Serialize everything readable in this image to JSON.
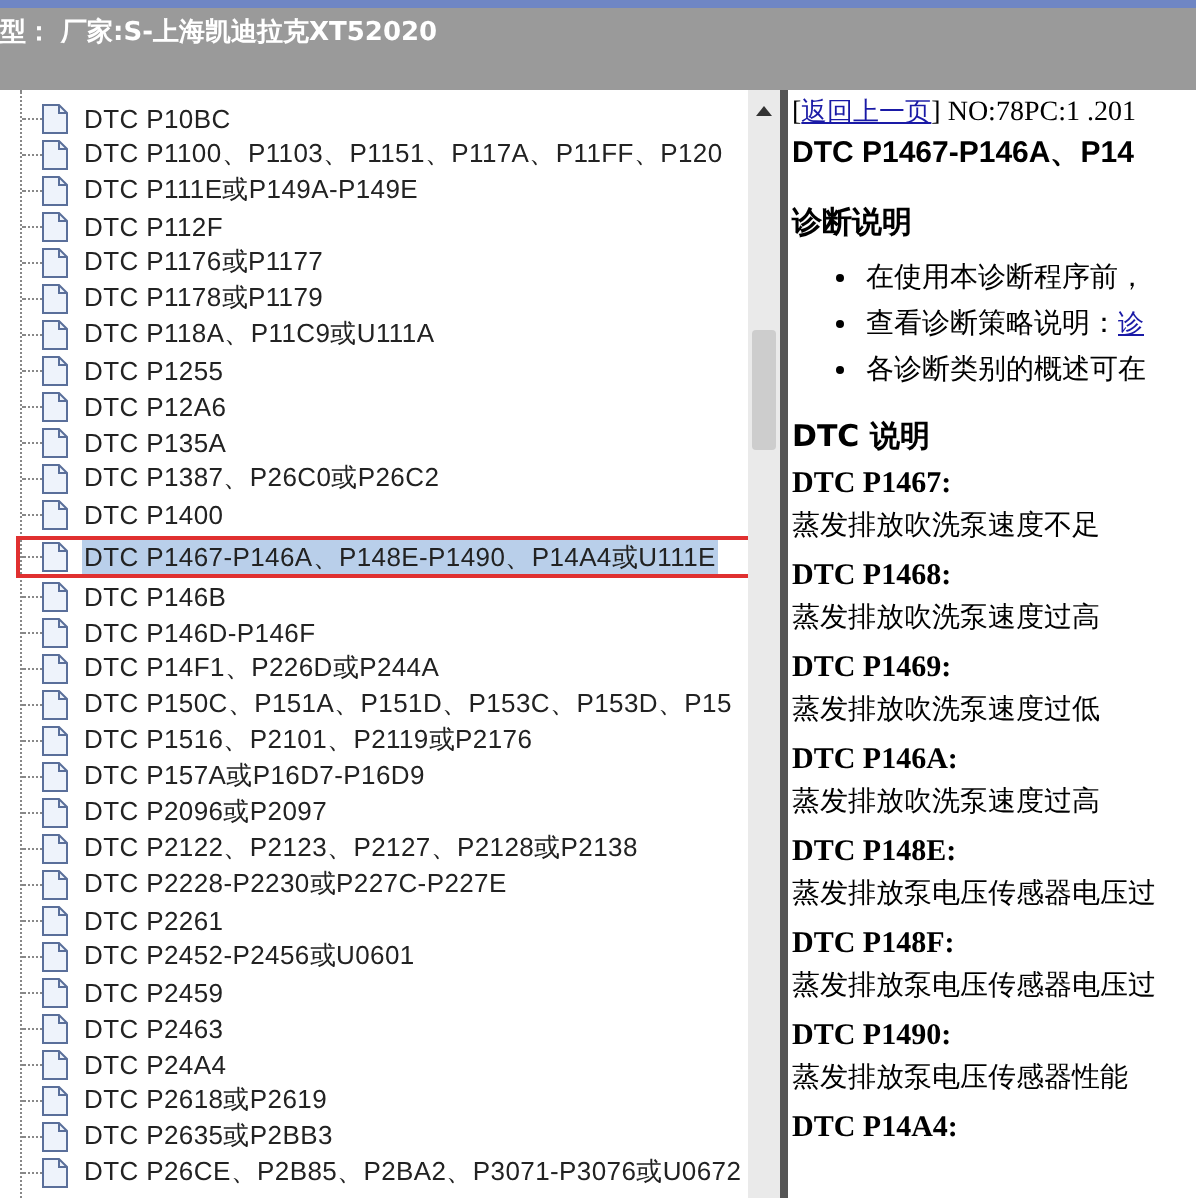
{
  "title_bar": {
    "text": "型： 厂家:S-上海凯迪拉克XT52020"
  },
  "tree": {
    "items": [
      {
        "label": "DTC P10BC",
        "selected": false
      },
      {
        "label": "DTC P1100、P1103、P1151、P117A、P11FF、P120",
        "selected": false
      },
      {
        "label": "DTC P111E或P149A-P149E",
        "selected": false
      },
      {
        "label": "DTC P112F",
        "selected": false
      },
      {
        "label": "DTC P1176或P1177",
        "selected": false
      },
      {
        "label": "DTC P1178或P1179",
        "selected": false
      },
      {
        "label": "DTC P118A、P11C9或U111A",
        "selected": false
      },
      {
        "label": "DTC P1255",
        "selected": false
      },
      {
        "label": "DTC P12A6",
        "selected": false
      },
      {
        "label": "DTC P135A",
        "selected": false
      },
      {
        "label": "DTC P1387、P26C0或P26C2",
        "selected": false
      },
      {
        "label": "DTC P1400",
        "selected": false
      },
      {
        "label": "DTC P1467-P146A、P148E-P1490、P14A4或U111E",
        "selected": true
      },
      {
        "label": "DTC P146B",
        "selected": false
      },
      {
        "label": "DTC P146D-P146F",
        "selected": false
      },
      {
        "label": "DTC P14F1、P226D或P244A",
        "selected": false
      },
      {
        "label": "DTC P150C、P151A、P151D、P153C、P153D、P15",
        "selected": false
      },
      {
        "label": "DTC P1516、P2101、P2119或P2176",
        "selected": false
      },
      {
        "label": "DTC P157A或P16D7-P16D9",
        "selected": false
      },
      {
        "label": "DTC P2096或P2097",
        "selected": false
      },
      {
        "label": "DTC P2122、P2123、P2127、P2128或P2138",
        "selected": false
      },
      {
        "label": "DTC P2228-P2230或P227C-P227E",
        "selected": false
      },
      {
        "label": "DTC P2261",
        "selected": false
      },
      {
        "label": "DTC P2452-P2456或U0601",
        "selected": false
      },
      {
        "label": "DTC P2459",
        "selected": false
      },
      {
        "label": "DTC P2463",
        "selected": false
      },
      {
        "label": "DTC P24A4",
        "selected": false
      },
      {
        "label": "DTC P2618或P2619",
        "selected": false
      },
      {
        "label": "DTC P2635或P2BB3",
        "selected": false
      },
      {
        "label": "DTC P26CE、P2B85、P2BA2、P3071-P3076或U0672",
        "selected": false
      }
    ]
  },
  "document": {
    "back_link": "返回上一页",
    "bracket_open": "[",
    "bracket_close": "]",
    "doc_number": "NO:78PC:1 .201",
    "title": "DTC P1467-P146A、P14",
    "section_1": "诊断说明",
    "bullets": [
      {
        "text": "在使用本诊断程序前，"
      },
      {
        "text": "查看诊断策略说明：",
        "link": "诊"
      },
      {
        "text": "各诊断类别的概述可在"
      }
    ],
    "section_2": "DTC 说明",
    "codes": [
      {
        "code": "DTC P1467:",
        "description": "蒸发排放吹洗泵速度不足"
      },
      {
        "code": "DTC P1468:",
        "description": "蒸发排放吹洗泵速度过高"
      },
      {
        "code": "DTC P1469:",
        "description": "蒸发排放吹洗泵速度过低"
      },
      {
        "code": "DTC P146A:",
        "description": "蒸发排放吹洗泵速度过高"
      },
      {
        "code": "DTC P148E:",
        "description": "蒸发排放泵电压传感器电压过"
      },
      {
        "code": "DTC P148F:",
        "description": "蒸发排放泵电压传感器电压过"
      },
      {
        "code": "DTC P1490:",
        "description": "蒸发排放泵电压传感器性能"
      },
      {
        "code": "DTC P14A4:"
      }
    ]
  }
}
